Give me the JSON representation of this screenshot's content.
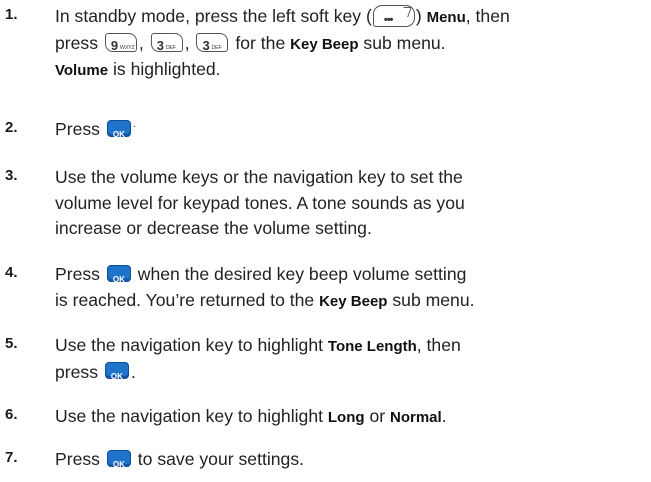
{
  "steps": [
    {
      "number": "1.",
      "line1_a": "In standby mode, press the left soft key (",
      "line1_b": ")",
      "line1_bold": "Menu",
      "line1_c": ", then",
      "line2_a": "press",
      "line2_b": "for the",
      "line2_bold": "Key Beep",
      "line2_c": "sub menu.",
      "line3_bold": "Volume",
      "line3_c": "is highlighted."
    },
    {
      "number": "2.",
      "text_a": "Press"
    },
    {
      "number": "3.",
      "line1": "Use the volume keys or the navigation key to set the",
      "line2": "volume level for keypad tones. A tone sounds as you",
      "line3": "increase or decrease the volume setting."
    },
    {
      "number": "4.",
      "line1_a": "Press",
      "line1_b": "when the desired key beep volume setting",
      "line2_a": "is reached. You’re returned to the",
      "line2_bold": "Key Beep",
      "line2_c": "sub menu."
    },
    {
      "number": "5.",
      "line1_a": "Use the navigation key to highlight",
      "line1_bold": "Tone Length",
      "line1_c": ", then",
      "line2_a": "press"
    },
    {
      "number": "6.",
      "text_a": "Use the navigation key to highlight",
      "bold1": "Long",
      "text_b": "or",
      "bold2": "Normal"
    },
    {
      "number": "7.",
      "text_a": "Press",
      "text_b": "to save your settings."
    }
  ],
  "keys": {
    "ok_label": "OK",
    "key9_big": "9",
    "key9_small": "WXYZ",
    "key3_big": "3",
    "key3_small": "DEF",
    "soft_dots": "•••"
  },
  "colors": {
    "ok_key": "#1f73c8",
    "text": "#222222"
  }
}
